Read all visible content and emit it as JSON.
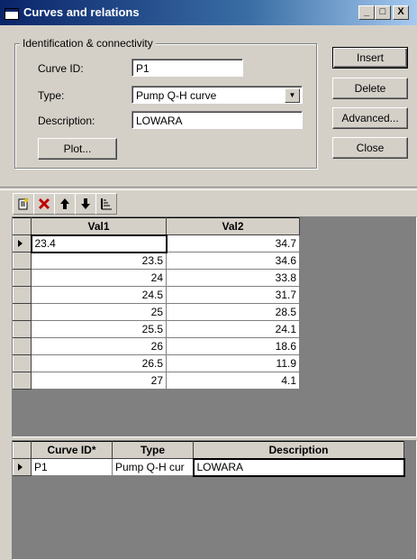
{
  "window": {
    "title": "Curves and relations",
    "controls": {
      "minimize": "_",
      "maximize": "□",
      "close": "X"
    }
  },
  "identification": {
    "group_label": "Identification & connectivity",
    "curve_id_label": "Curve ID:",
    "curve_id_value": "P1",
    "type_label": "Type:",
    "type_value": "Pump Q-H curve",
    "description_label": "Description:",
    "description_value": "LOWARA",
    "plot_button": "Plot..."
  },
  "buttons": {
    "insert": "Insert",
    "delete": "Delete",
    "advanced": "Advanced...",
    "close": "Close"
  },
  "toolbar": {
    "icons": [
      "new-record-icon",
      "delete-record-icon",
      "move-up-icon",
      "move-down-icon",
      "sort-icon"
    ]
  },
  "values_grid": {
    "columns": [
      "Val1",
      "Val2"
    ],
    "rows": [
      {
        "val1": "23.4",
        "val2": "34.7"
      },
      {
        "val1": "23.5",
        "val2": "34.6"
      },
      {
        "val1": "24",
        "val2": "33.8"
      },
      {
        "val1": "24.5",
        "val2": "31.7"
      },
      {
        "val1": "25",
        "val2": "28.5"
      },
      {
        "val1": "25.5",
        "val2": "24.1"
      },
      {
        "val1": "26",
        "val2": "18.6"
      },
      {
        "val1": "26.5",
        "val2": "11.9"
      },
      {
        "val1": "27",
        "val2": "4.1"
      }
    ]
  },
  "curves_grid": {
    "columns": [
      "Curve ID*",
      "Type",
      "Description"
    ],
    "rows": [
      {
        "curve_id": "P1",
        "type": "Pump Q-H cur",
        "description": "LOWARA"
      }
    ]
  }
}
